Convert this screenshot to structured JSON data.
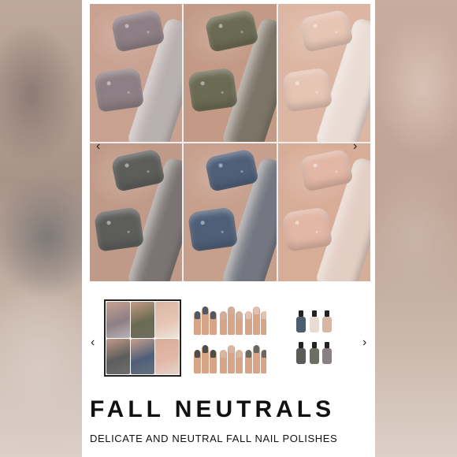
{
  "product": {
    "title": "FALL NEUTRALS",
    "subtitle": "DELICATE AND NEUTRAL FALL NAIL POLISHES"
  },
  "gallery": {
    "prev_icon": "chevron-left-icon",
    "next_icon": "chevron-right-icon",
    "prev_glyph": "‹",
    "next_glyph": "›",
    "swatches": [
      {
        "name": "mauve-glitter",
        "nail": "#8d7f85",
        "skin": "#c8a191",
        "bottle": "#b7b3b6"
      },
      {
        "name": "olive-glitter",
        "nail": "#6b6a52",
        "skin": "#c39a85",
        "bottle": "#6f6e62"
      },
      {
        "name": "nude-shimmer",
        "nail": "#e6c5b4",
        "skin": "#dcb6a3",
        "bottle": "#ede3dc"
      },
      {
        "name": "charcoal-glitter",
        "nail": "#5d5d5c",
        "skin": "#c09a88",
        "bottle": "#6f6e70"
      },
      {
        "name": "denim-glitter",
        "nail": "#4f5f78",
        "skin": "#c79f8d",
        "bottle": "#66717f"
      },
      {
        "name": "blush-shimmer",
        "nail": "#e2b7a6",
        "skin": "#d8ad98",
        "bottle": "#e5d4cb"
      }
    ]
  },
  "thumbnails": {
    "selected_index": 0,
    "items": [
      {
        "name": "swatch-grid-thumb"
      },
      {
        "name": "hands-thumb",
        "colors": [
          "#4d5a6a",
          "#d3ad9a",
          "#e2c1b0",
          "#4c4c4a",
          "#d9b6a1",
          "#6a6760"
        ]
      },
      {
        "name": "bottles-thumb",
        "colors": [
          "#4b5e6f",
          "#e9dcd1",
          "#d8b8a4",
          "#5b5c58",
          "#6f6e64",
          "#8a7f82"
        ]
      }
    ]
  }
}
